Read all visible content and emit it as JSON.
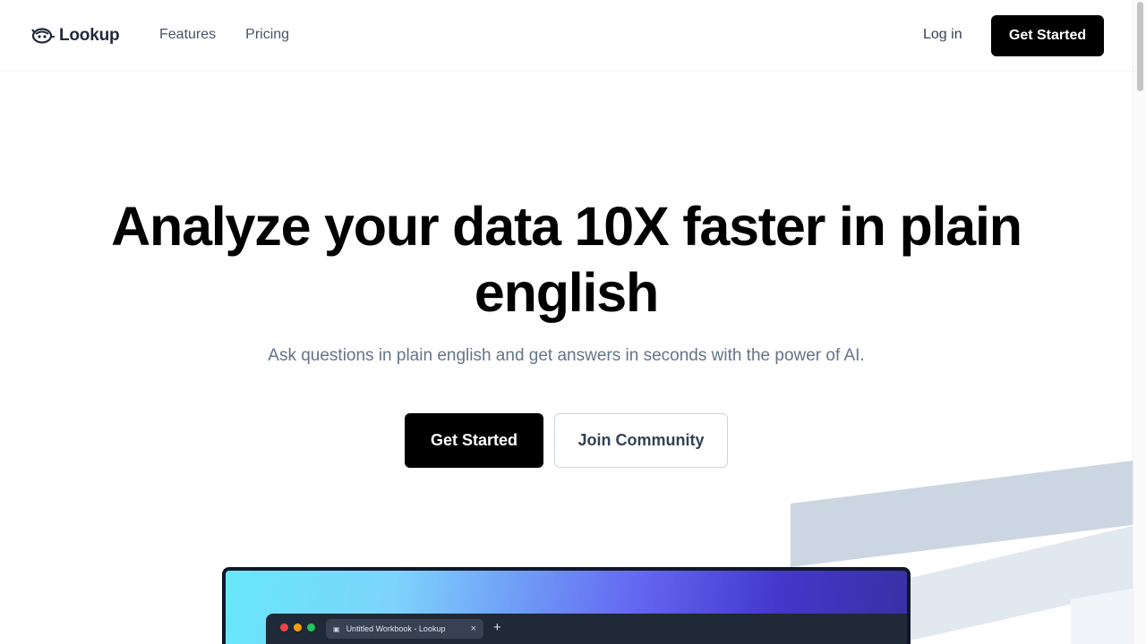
{
  "header": {
    "brand": "Lookup",
    "nav": [
      {
        "label": "Features"
      },
      {
        "label": "Pricing"
      }
    ],
    "login_label": "Log in",
    "cta_label": "Get Started"
  },
  "hero": {
    "title_line1": "Analyze your data 10X faster in plain",
    "title_line2": "english",
    "subtitle": "Ask questions in plain english and get answers in seconds with the power of AI.",
    "primary_cta": "Get Started",
    "secondary_cta": "Join Community"
  },
  "preview": {
    "tab_title": "Untitled Workbook - Lookup",
    "tab_close": "×",
    "new_tab": "+",
    "window_dots": [
      "#ef4444",
      "#f59e0b",
      "#22c55e"
    ]
  },
  "colors": {
    "primary": "#000000",
    "text_muted": "#64748b",
    "deco_shape": "#cbd5e1"
  }
}
